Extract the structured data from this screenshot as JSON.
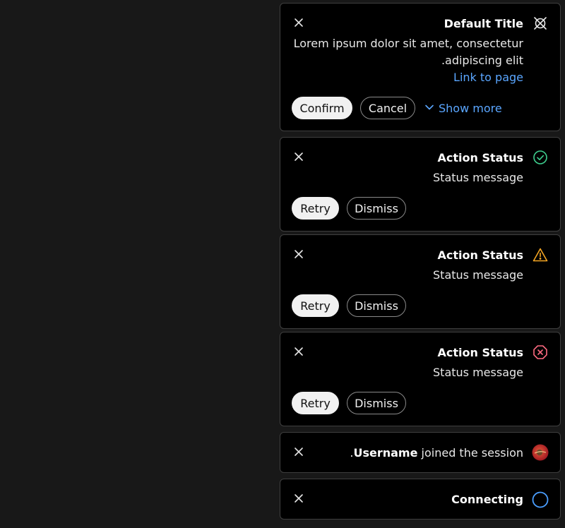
{
  "toasts": [
    {
      "kind": "default",
      "title": "Default Title",
      "body_line1": "Lorem ipsum dolor sit amet, consectetur",
      "body_line2": ".adipiscing elit",
      "link": "Link to page",
      "primary_label": "Confirm",
      "secondary_label": "Cancel",
      "show_more_label": "Show more",
      "icon": "no-connection-icon"
    },
    {
      "kind": "success",
      "title": "Action Status",
      "message": "Status message",
      "primary_label": "Retry",
      "secondary_label": "Dismiss",
      "icon": "check-circle-icon",
      "color": "#3ecf8e"
    },
    {
      "kind": "warning",
      "title": "Action Status",
      "message": "Status message",
      "primary_label": "Retry",
      "secondary_label": "Dismiss",
      "icon": "warning-triangle-icon",
      "color": "#f5a623"
    },
    {
      "kind": "error",
      "title": "Action Status",
      "message": "Status message",
      "primary_label": "Retry",
      "secondary_label": "Dismiss",
      "icon": "error-octagon-icon",
      "color": "#ff6b81"
    },
    {
      "kind": "user-joined",
      "prefix": ".",
      "username": "Username",
      "suffix": " joined the session",
      "icon": "avatar"
    },
    {
      "kind": "loading",
      "title": "Connecting",
      "icon": "loading-spinner-icon",
      "color": "#4a9eff"
    }
  ],
  "colors": {
    "background": "#181818",
    "toast_bg": "#000000",
    "link": "#5aa6ff"
  }
}
